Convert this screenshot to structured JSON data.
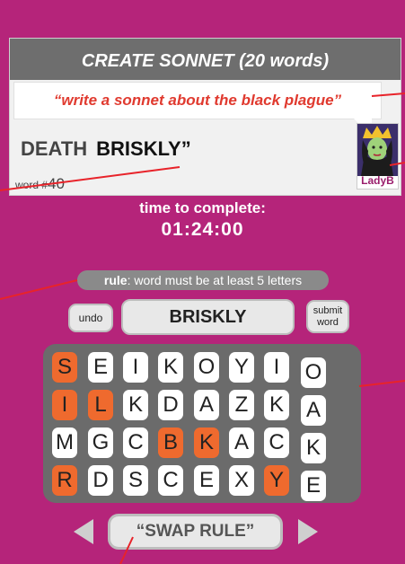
{
  "header": {
    "title": "CREATE SONNET (20 words)"
  },
  "prompt": {
    "text": "“write a sonnet about the black plague”"
  },
  "sonnet": {
    "word1": "DEATH",
    "word2": "BRISKLY”"
  },
  "word_count": {
    "label": "word #",
    "value": "40"
  },
  "opponent": {
    "name": "LadyB"
  },
  "timer": {
    "label": "time to complete:",
    "value": "01:24:00"
  },
  "rule": {
    "label": "rule",
    "text": ": word must be at least 5 letters"
  },
  "controls": {
    "undo_label": "undo",
    "submit_label": "submit word",
    "current_word": "BRISKLY"
  },
  "board": {
    "rows": [
      [
        "S",
        "E",
        "I",
        "K",
        "O",
        "Y",
        "I",
        "O"
      ],
      [
        "I",
        "L",
        "K",
        "D",
        "A",
        "Z",
        "K",
        "A"
      ],
      [
        "M",
        "G",
        "C",
        "B",
        "K",
        "A",
        "C",
        "K"
      ],
      [
        "R",
        "D",
        "S",
        "C",
        "E",
        "X",
        "Y",
        "E"
      ]
    ],
    "selected": [
      [
        0,
        0
      ],
      [
        1,
        0
      ],
      [
        1,
        1
      ],
      [
        2,
        3
      ],
      [
        2,
        4
      ],
      [
        3,
        0
      ],
      [
        3,
        6
      ]
    ],
    "selected_color": "#ef6a2e"
  },
  "swap": {
    "label": "“SWAP RULE”"
  },
  "colors": {
    "background": "#b5247a",
    "header": "#6e6e6e",
    "prompt_text": "#e03a2f",
    "callout": "#e8232a"
  }
}
